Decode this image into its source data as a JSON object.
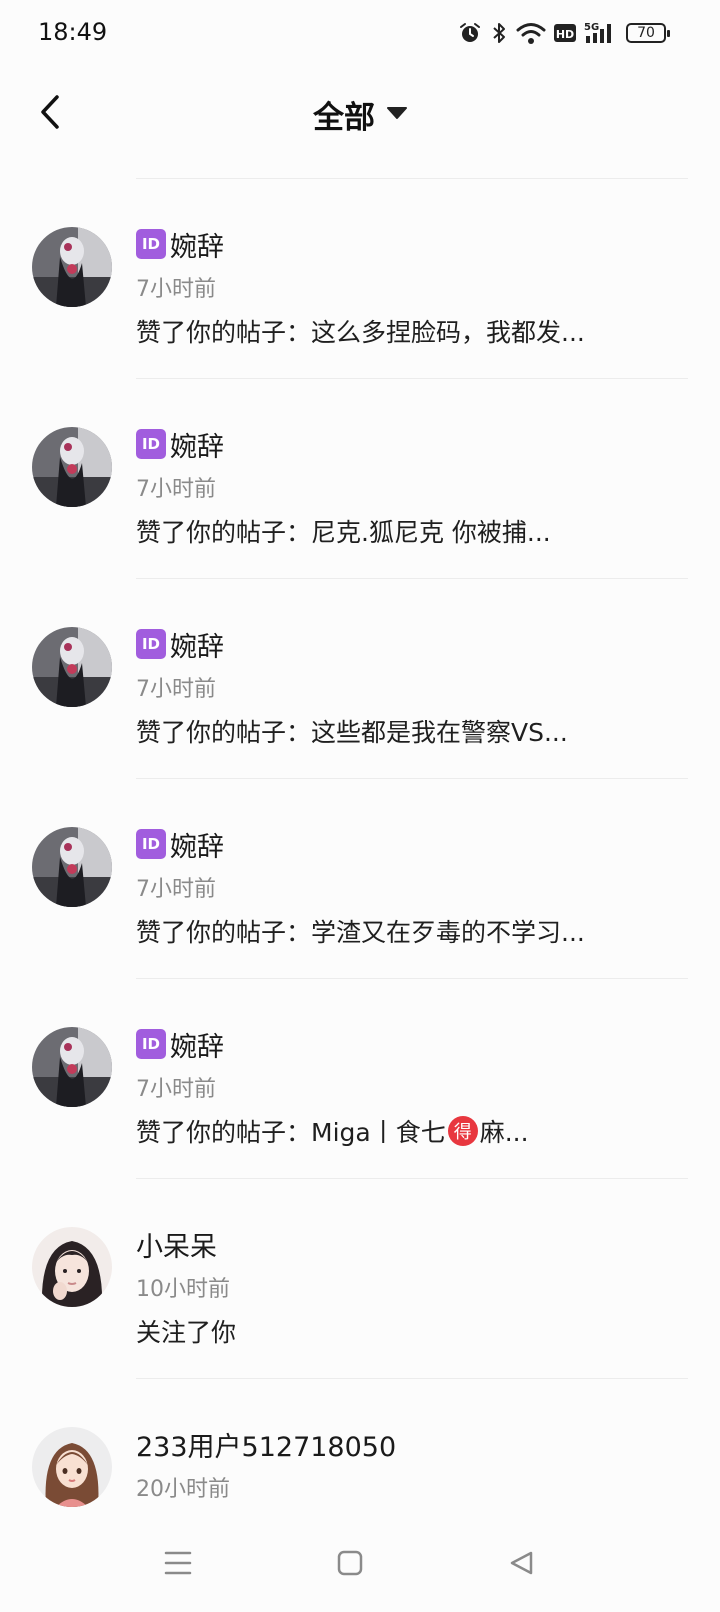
{
  "status_bar": {
    "time": "18:49",
    "battery": "70",
    "icons": [
      "alarm-icon",
      "bluetooth-icon",
      "wifi-icon",
      "hd-icon",
      "signal-5g-icon",
      "battery-icon"
    ]
  },
  "header": {
    "title": "全部",
    "back_icon": "chevron-left-icon",
    "dropdown_icon": "caret-down-icon"
  },
  "notifications": [
    {
      "id_badge": "ID",
      "username": "婉辞",
      "time": "7小时前",
      "message": "赞了你的帖子：这么多捏脸码，我都发..."
    },
    {
      "id_badge": "ID",
      "username": "婉辞",
      "time": "7小时前",
      "message": "赞了你的帖子：尼克.狐尼克 你被捕..."
    },
    {
      "id_badge": "ID",
      "username": "婉辞",
      "time": "7小时前",
      "message": "赞了你的帖子：这些都是我在警察VS..."
    },
    {
      "id_badge": "ID",
      "username": "婉辞",
      "time": "7小时前",
      "message": "赞了你的帖子：学渣又在歹毒的不学习..."
    },
    {
      "id_badge": "ID",
      "username": "婉辞",
      "time": "7小时前",
      "message_prefix": "赞了你的帖子：Miga丨食七",
      "message_badge": "得",
      "message_suffix": "麻..."
    },
    {
      "username": "小呆呆",
      "time": "10小时前",
      "message": "关注了你"
    },
    {
      "username": "233用户512718050",
      "time": "20小时前"
    }
  ],
  "nav_bar": {
    "icons": [
      "menu-icon",
      "home-square-icon",
      "back-triangle-icon"
    ]
  }
}
